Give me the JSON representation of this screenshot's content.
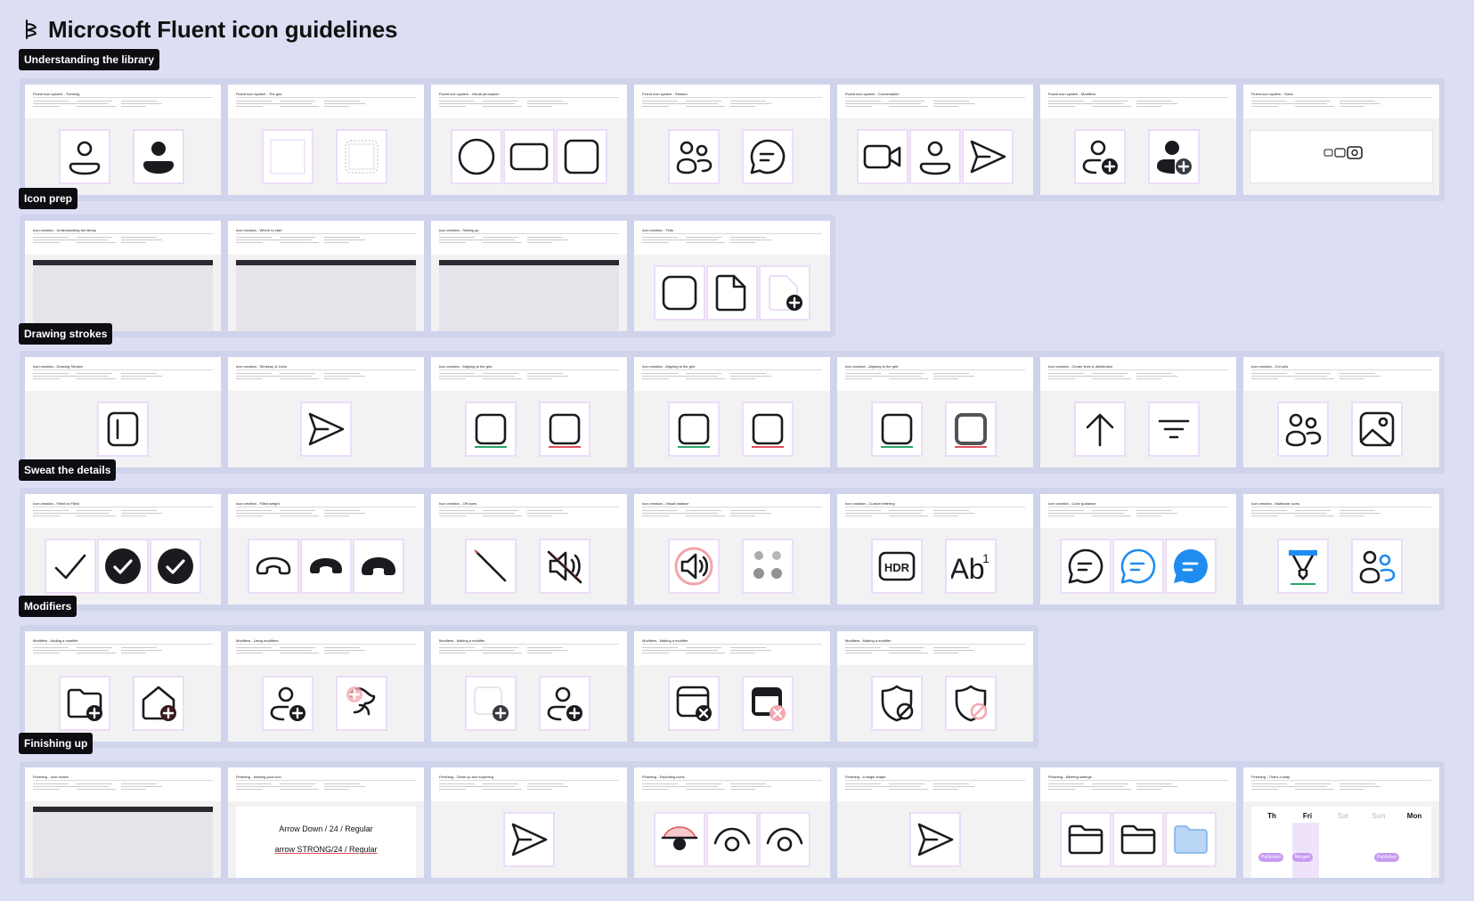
{
  "page": {
    "title": "Microsoft Fluent icon guidelines",
    "logo_icon": "fluent-brush-logo-icon",
    "background": "#dcdff4"
  },
  "sections": [
    {
      "label": "Understanding the library",
      "cards": [
        {
          "title": "Fluent icon system - Theming",
          "icons": [
            "person-outline-icon",
            "person-filled-icon"
          ]
        },
        {
          "title": "Fluent icon system - The grid",
          "icons": [
            "grid-square-icon",
            "grid-rounded-square-icon"
          ]
        },
        {
          "title": "Fluent icon system - Visual perception",
          "icons": [
            "circle-shape-icon",
            "rounded-rect-icon",
            "square-shape-icon"
          ]
        },
        {
          "title": "Fluent icon system - Stroken",
          "icons": [
            "people-icon",
            "chat-bubble-icon"
          ]
        },
        {
          "title": "Fluent icon system - Conversation",
          "icons": [
            "video-camera-icon",
            "person-outline-icon",
            "send-icon"
          ]
        },
        {
          "title": "Fluent icon system - Modifiers",
          "icons": [
            "person-add-outline-icon",
            "person-add-filled-icon"
          ]
        },
        {
          "title": "Fluent icon system - Sizes",
          "icons": [
            "camera-sizes-icon"
          ]
        }
      ]
    },
    {
      "label": "Icon prep",
      "cards": [
        {
          "title": "Icon creation - Understanding the library",
          "icons": []
        },
        {
          "title": "Icon creation - Where to start",
          "icons": []
        },
        {
          "title": "Icon creation - Setting up",
          "icons": []
        },
        {
          "title": "Icon creation - Tints",
          "icons": [
            "rounded-square-icon",
            "document-icon",
            "document-add-icon"
          ]
        }
      ]
    },
    {
      "label": "Drawing strokes",
      "cards": [
        {
          "title": "Icon creation - Drawing Strokes",
          "icons": [
            "panel-left-icon"
          ]
        },
        {
          "title": "Icon creation - Strokeup & Joins",
          "icons": [
            "send-icon"
          ]
        },
        {
          "title": "Icon creation - Aligning to the grid",
          "icons": [
            "square-aligned-icon",
            "square-misaligned-icon"
          ]
        },
        {
          "title": "Icon creation - Aligning to the grid",
          "icons": [
            "square-aligned-icon",
            "square-misaligned-icon"
          ]
        },
        {
          "title": "Icon creation - Aligning to the grid",
          "icons": [
            "square-aligned-icon",
            "square-blurred-icon"
          ]
        },
        {
          "title": "Icon creation - Center lines & distribution",
          "icons": [
            "arrow-up-icon",
            "filter-icon"
          ]
        },
        {
          "title": "Icon creation - Cut outs",
          "icons": [
            "people-icon",
            "image-icon"
          ]
        }
      ]
    },
    {
      "label": "Sweat the details",
      "cards": [
        {
          "title": "Icon creation - Filled vs Filled",
          "icons": [
            "checkmark-icon",
            "checkmark-circle-filled-icon",
            "checkmark-circle-filled-icon"
          ]
        },
        {
          "title": "Icon creation - Filled weight",
          "icons": [
            "call-end-outline-icon",
            "call-end-filled-icon",
            "call-end-bold-icon"
          ]
        },
        {
          "title": "Icon creation - Off icons",
          "icons": [
            "slash-icon",
            "speaker-off-icon"
          ]
        },
        {
          "title": "Icon creation - Visual balance",
          "icons": [
            "speaker-icon",
            "people-blur-icon"
          ]
        },
        {
          "title": "Icon creation - Custom lettering",
          "icons": [
            "hdr-icon",
            "text-superscript-icon"
          ]
        },
        {
          "title": "Icon creation - Color guidance",
          "icons": [
            "chat-bubble-icon",
            "chat-bubble-blue-icon",
            "chat-bubble-filled-blue-icon"
          ]
        },
        {
          "title": "Icon creation - Multicolor icons",
          "icons": [
            "highlighter-icon",
            "people-color-icon"
          ]
        }
      ]
    },
    {
      "label": "Modifiers",
      "cards": [
        {
          "title": "Modifiers - Adding a modifier",
          "icons": [
            "folder-add-icon",
            "home-add-icon"
          ]
        },
        {
          "title": "Modifiers - Using modifiers",
          "icons": [
            "person-add-outline-icon",
            "animal-add-icon"
          ]
        },
        {
          "title": "Modifiers - Making a modifier",
          "icons": [
            "panel-add-icon",
            "person-add-outline-icon"
          ]
        },
        {
          "title": "Modifiers - Making a modifier",
          "icons": [
            "window-dismiss-icon",
            "window-dismiss-filled-icon"
          ]
        },
        {
          "title": "Modifiers - Making a modifier",
          "icons": [
            "shield-prohibited-icon",
            "shield-prohibited-red-icon"
          ]
        }
      ]
    },
    {
      "label": "Finishing up",
      "cards": [
        {
          "title": "Finishing - Icon review",
          "icons": []
        },
        {
          "title": "Finishing - Naming your icon",
          "name_line1": "Arrow Down / 24 / Regular",
          "name_line2": "arrow STRONG/24 / Regular",
          "icons": []
        },
        {
          "title": "Finishing - Clean up and exporting",
          "icons": [
            "send-icon"
          ]
        },
        {
          "title": "Finishing - Exploding icons",
          "icons": [
            "eye-hidden-icon",
            "eye-icon",
            "eye-icon"
          ]
        },
        {
          "title": "Finishing - A single shape",
          "icons": [
            "send-icon"
          ]
        },
        {
          "title": "Finishing - Meeting settings",
          "icons": [
            "folder-icon",
            "folder-icon",
            "folder-blue-icon"
          ]
        },
        {
          "title": "Finishing - That's a wrap",
          "days": [
            "Th",
            "Fri",
            "Sat",
            "Sun",
            "Mon"
          ],
          "tags": [
            "Published",
            "Merged",
            "Published"
          ]
        }
      ]
    }
  ],
  "colors": {
    "row_bg": "#cfd3ec",
    "label_bg": "#0d0d12",
    "frame_outline": "#ecdcf8",
    "accent_purple": "#c79af0",
    "accent_blue": "#1f8cf0",
    "accent_red": "#e0505a",
    "accent_green": "#2ca46a"
  }
}
